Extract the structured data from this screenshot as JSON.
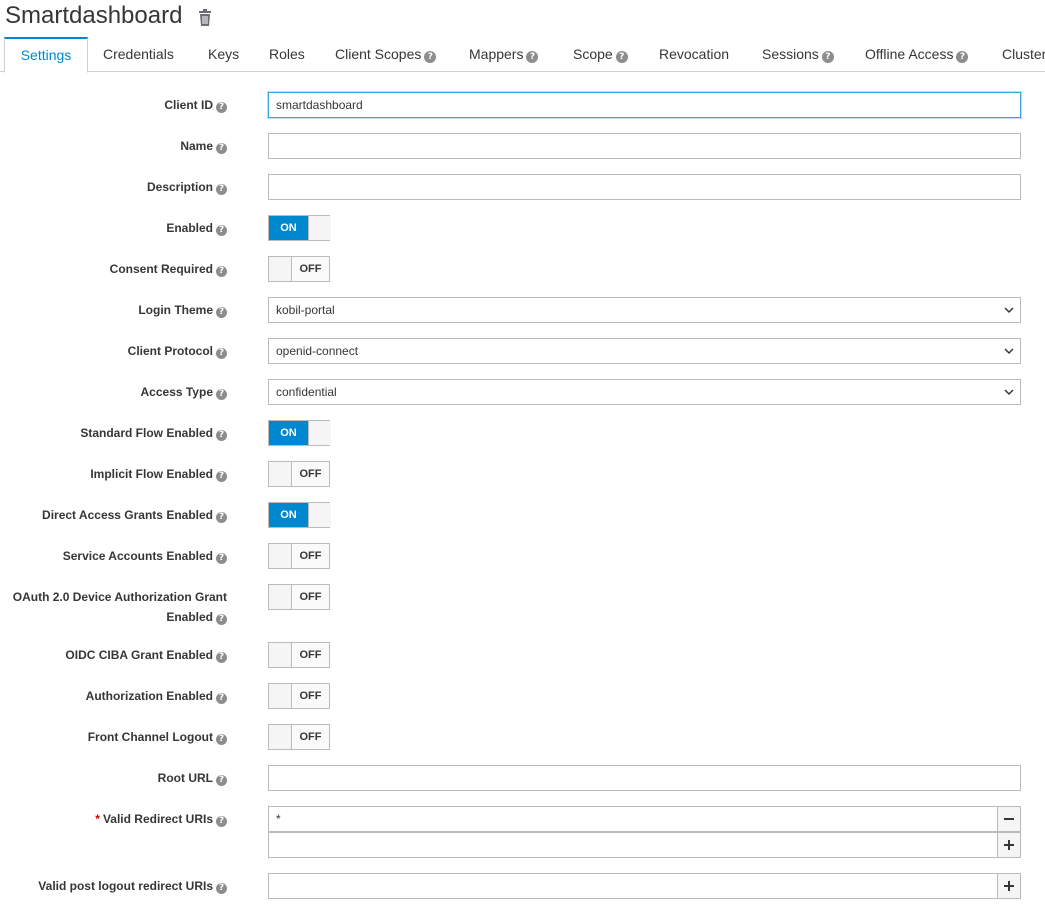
{
  "header": {
    "title": "Smartdashboard",
    "delete_icon": "trash-icon"
  },
  "tabs": [
    {
      "label": "Settings",
      "active": true,
      "help": false
    },
    {
      "label": "Credentials",
      "help": false
    },
    {
      "label": "Keys",
      "help": false
    },
    {
      "label": "Roles",
      "help": false
    },
    {
      "label": "Client Scopes",
      "help": true
    },
    {
      "label": "Mappers",
      "help": true
    },
    {
      "label": "Scope",
      "help": true
    },
    {
      "label": "Revocation",
      "help": false
    },
    {
      "label": "Sessions",
      "help": true
    },
    {
      "label": "Offline Access",
      "help": true
    },
    {
      "label": "Clusterin",
      "help": false
    }
  ],
  "help_glyph": "?",
  "form": {
    "client_id": {
      "label": "Client ID",
      "value": "smartdashboard"
    },
    "name": {
      "label": "Name",
      "value": ""
    },
    "description": {
      "label": "Description",
      "value": ""
    },
    "enabled": {
      "label": "Enabled",
      "state": "ON"
    },
    "consent_required": {
      "label": "Consent Required",
      "state": "OFF"
    },
    "login_theme": {
      "label": "Login Theme",
      "value": "kobil-portal"
    },
    "client_protocol": {
      "label": "Client Protocol",
      "value": "openid-connect"
    },
    "access_type": {
      "label": "Access Type",
      "value": "confidential"
    },
    "standard_flow": {
      "label": "Standard Flow Enabled",
      "state": "ON"
    },
    "implicit_flow": {
      "label": "Implicit Flow Enabled",
      "state": "OFF"
    },
    "direct_access": {
      "label": "Direct Access Grants Enabled",
      "state": "ON"
    },
    "service_accounts": {
      "label": "Service Accounts Enabled",
      "state": "OFF"
    },
    "oauth_device_line1": "OAuth 2.0 Device Authorization Grant",
    "oauth_device": {
      "label": "Enabled",
      "state": "OFF"
    },
    "oidc_ciba": {
      "label": "OIDC CIBA Grant Enabled",
      "state": "OFF"
    },
    "authorization": {
      "label": "Authorization Enabled",
      "state": "OFF"
    },
    "front_channel_logout": {
      "label": "Front Channel Logout",
      "state": "OFF"
    },
    "root_url": {
      "label": "Root URL",
      "value": ""
    },
    "valid_redirect_uris": {
      "required_mark": "*",
      "label": "Valid Redirect URIs",
      "values": [
        "*",
        ""
      ]
    },
    "valid_post_logout": {
      "label": "Valid post logout redirect URIs",
      "value": ""
    }
  },
  "buttons": {
    "remove": "−",
    "add": "+"
  },
  "colors": {
    "accent": "#0088ce",
    "focus": "#39a5dc",
    "required": "#cc0000"
  }
}
